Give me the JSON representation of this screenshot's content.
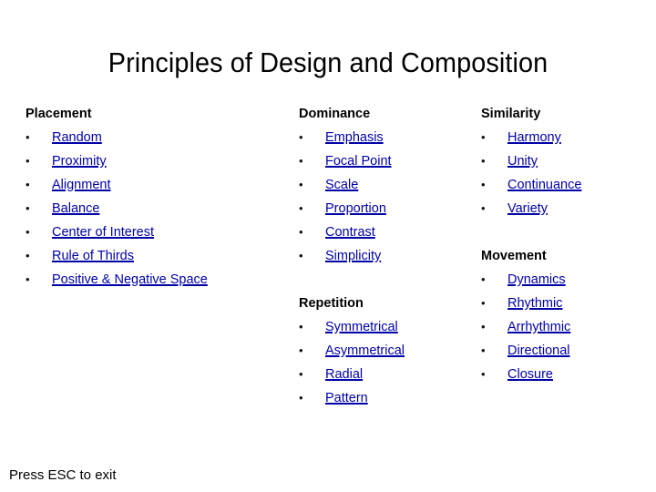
{
  "slide": {
    "title": "Principles of Design and Composition",
    "footer_note": "Press ESC to exit",
    "bullet_glyph": "•",
    "link_color": "#0000A8",
    "heading_color": "#000000",
    "background_color": "#FFFFFF"
  },
  "columns": [
    {
      "name": "column-left",
      "groups": [
        {
          "heading": "Placement",
          "items": [
            "Random",
            "Proximity",
            "Alignment",
            "Balance",
            "Center of Interest",
            "Rule of Thirds",
            "Positive & Negative Space"
          ]
        }
      ]
    },
    {
      "name": "column-middle",
      "groups": [
        {
          "heading": "Dominance",
          "items": [
            "Emphasis",
            "Focal Point",
            "Scale",
            "Proportion",
            "Contrast",
            "Simplicity"
          ]
        },
        {
          "heading": "Repetition",
          "items": [
            "Symmetrical",
            "Asymmetrical",
            "Radial",
            "Pattern"
          ]
        }
      ]
    },
    {
      "name": "column-right",
      "groups": [
        {
          "heading": "Similarity",
          "items": [
            "Harmony",
            "Unity",
            "Continuance",
            "Variety"
          ]
        },
        {
          "heading": "Movement",
          "items": [
            "Dynamics",
            "Rhythmic",
            "Arrhythmic",
            "Directional",
            "Closure"
          ]
        }
      ]
    }
  ]
}
